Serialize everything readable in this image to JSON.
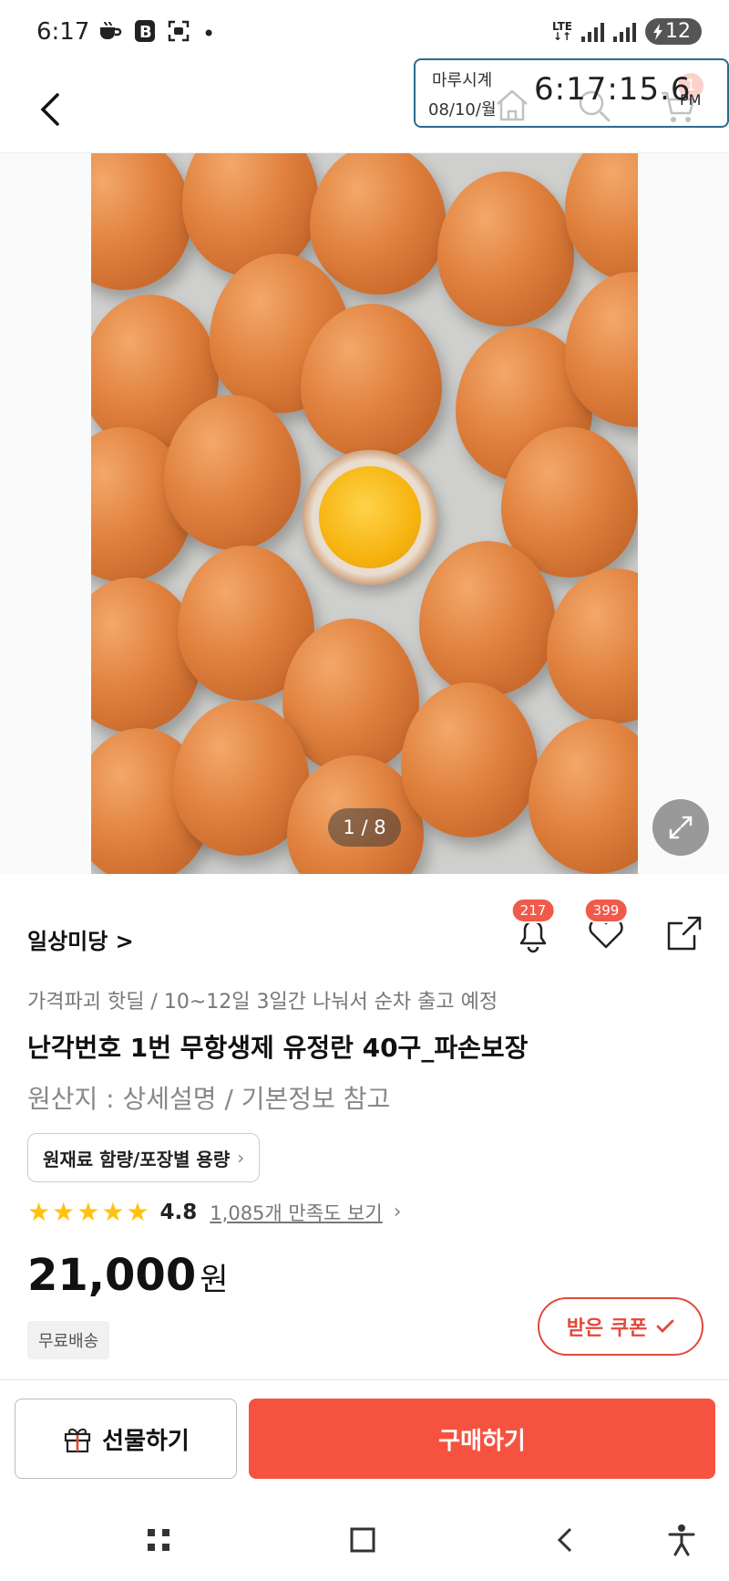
{
  "status_bar": {
    "time": "6:17",
    "lte": "LTE",
    "battery": "12",
    "dot": "•"
  },
  "clock_overlay": {
    "label": "마루시계",
    "date": "08/10/월",
    "time": "6:17:15.6",
    "ampm": "PM"
  },
  "header": {
    "cart_count": "1"
  },
  "product_image": {
    "counter": "1 / 8"
  },
  "seller": {
    "name": "일상미당 >",
    "alert_count": "217",
    "like_count": "399"
  },
  "product": {
    "promo": "가격파괴 핫딜 / 10~12일 3일간 나눠서 순차 출고 예정",
    "title": "난각번호 1번 무항생제 유정란 40구_파손보장",
    "origin": "원산지 : 상세설명 / 기본정보 참고",
    "ingredient_button": "원재료 함량/포장별 용량",
    "rating": 4.8,
    "rating_text": "4.8",
    "review_link": "1,085개 만족도 보기",
    "price": "21,000",
    "price_unit": "원",
    "shipping": "무료배송",
    "coupon_button": "받은 쿠폰"
  },
  "actions": {
    "gift": "선물하기",
    "buy": "구매하기"
  },
  "colors": {
    "accent": "#f55340",
    "coupon": "#e24a3b",
    "star": "#ffc20e"
  }
}
